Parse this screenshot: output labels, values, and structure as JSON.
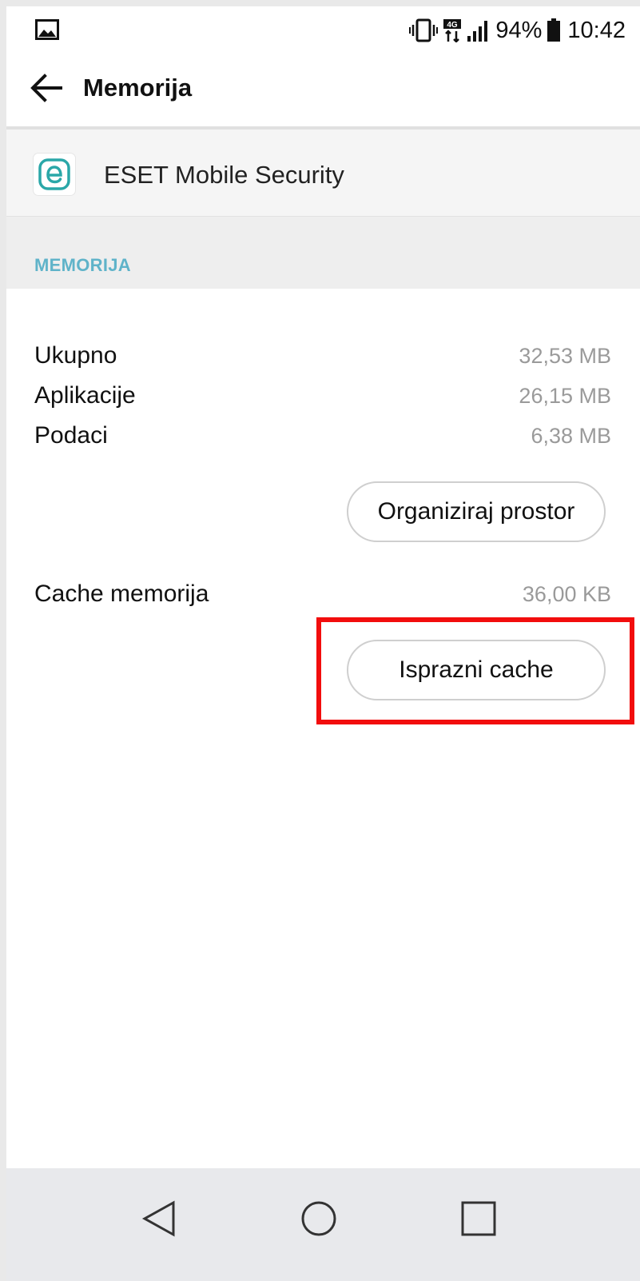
{
  "status_bar": {
    "battery_percent": "94%",
    "time": "10:42",
    "network_label": "4G"
  },
  "app_bar": {
    "title": "Memorija"
  },
  "app": {
    "name": "ESET Mobile Security",
    "icon": "eset-logo-icon",
    "icon_color": "#2aa7a8"
  },
  "storage": {
    "section_title": "MEMORIJA",
    "rows": [
      {
        "label": "Ukupno",
        "value": "32,53 MB"
      },
      {
        "label": "Aplikacije",
        "value": "26,15 MB"
      },
      {
        "label": "Podaci",
        "value": "6,38 MB"
      }
    ],
    "organize_button": "Organiziraj prostor"
  },
  "cache": {
    "label": "Cache memorija",
    "value": "36,00 KB",
    "clear_button": "Isprazni cache"
  },
  "colors": {
    "accent": "#5fb3c9",
    "highlight": "#f20d0d"
  }
}
